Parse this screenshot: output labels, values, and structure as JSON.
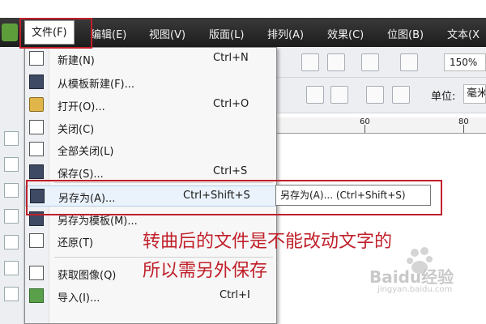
{
  "menubar": {
    "items": [
      "文件(F)",
      "编辑(E)",
      "视图(V)",
      "版面(L)",
      "排列(A)",
      "效果(C)",
      "位图(B)",
      "文本(X"
    ]
  },
  "toolbar": {
    "zoom": "150%",
    "unit_label": "单位:",
    "unit_value": "毫米"
  },
  "ruler": {
    "marks": [
      "60",
      "80"
    ]
  },
  "file_menu": {
    "items": [
      {
        "label": "新建(N)",
        "shortcut": "Ctrl+N",
        "icon": "new-document-icon"
      },
      {
        "label": "从模板新建(F)...",
        "shortcut": "",
        "icon": "template-icon"
      },
      {
        "label": "打开(O)...",
        "shortcut": "Ctrl+O",
        "icon": "folder-open-icon"
      },
      {
        "label": "关闭(C)",
        "shortcut": "",
        "icon": "close-document-icon"
      },
      {
        "label": "全部关闭(L)",
        "shortcut": "",
        "icon": "close-all-icon"
      },
      {
        "label": "保存(S)...",
        "shortcut": "Ctrl+S",
        "icon": "save-icon"
      },
      {
        "label": "另存为(A)...",
        "shortcut": "Ctrl+Shift+S",
        "icon": "save-as-icon"
      },
      {
        "label": "另存为模板(M)...",
        "shortcut": "",
        "icon": "save-template-icon"
      },
      {
        "label": "还原(T)",
        "shortcut": "",
        "icon": "revert-icon"
      },
      {
        "label": "获取图像(Q)",
        "shortcut": "",
        "icon": "acquire-image-icon"
      },
      {
        "label": "导入(I)...",
        "shortcut": "Ctrl+I",
        "icon": "import-icon"
      }
    ]
  },
  "tooltip": "另存为(A)... (Ctrl+Shift+S)",
  "annotation": {
    "line1": "转曲后的文件是不能改动文字的",
    "line2": "所以需另外保存"
  },
  "watermark": {
    "brand": "Baidu经验",
    "sub": "jingyan.baidu.com"
  },
  "colors": {
    "annotation_red": "#c0202a",
    "menubar_dark": "#1c1c1c",
    "highlight": "#eaf2fb"
  }
}
